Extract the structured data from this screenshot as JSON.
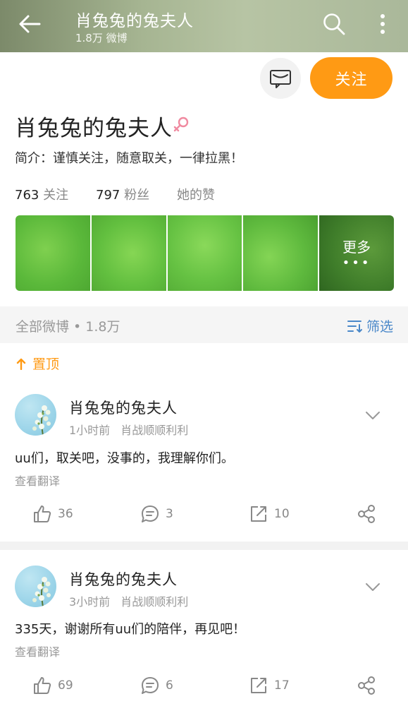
{
  "header": {
    "title": "肖兔兔的兔夫人",
    "subtitle": "1.8万 微博",
    "back_icon": "back-arrow-icon",
    "search_icon": "search-icon",
    "more_icon": "more-vertical-icon"
  },
  "actions": {
    "message_icon": "message-icon",
    "follow_label": "关注"
  },
  "profile": {
    "name": "肖兔兔的兔夫人",
    "gender_icon": "female-icon",
    "bio": "简介：谨慎关注，随意取关，一律拉黑！",
    "following_count": "763",
    "following_label": "关注",
    "followers_count": "797",
    "followers_label": "粉丝",
    "likes_label": "她的赞"
  },
  "photos": {
    "more_label": "更多",
    "more_dots": "•••"
  },
  "feed": {
    "section_label": "全部微博 • 1.8万",
    "filter_label": "筛选",
    "pinned_label": "置顶"
  },
  "posts": [
    {
      "author": "肖兔兔的兔夫人",
      "time": "1小时前",
      "source": "肖战顺顺利利",
      "content": "uu们，取关吧，没事的，我理解你们。",
      "translate": "查看翻译",
      "likes": "36",
      "comments": "3",
      "reposts": "10"
    },
    {
      "author": "肖兔兔的兔夫人",
      "time": "3小时前",
      "source": "肖战顺顺利利",
      "content": "335天，谢谢所有uu们的陪伴，再见吧！",
      "translate": "查看翻译",
      "likes": "69",
      "comments": "6",
      "reposts": "17"
    }
  ],
  "colors": {
    "accent": "#ff9a14",
    "link": "#4a88c9",
    "muted": "#999999"
  }
}
